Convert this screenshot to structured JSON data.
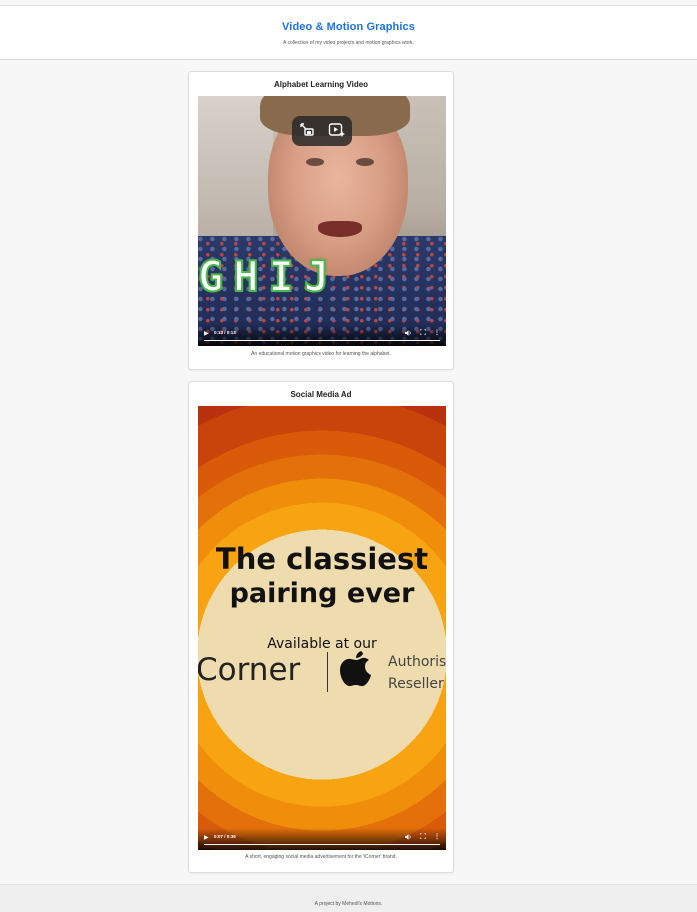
{
  "header": {
    "title": "Video & Motion Graphics",
    "subtitle": "A collection of my video projects and motion graphics work."
  },
  "projects": [
    {
      "title": "Alphabet Learning Video",
      "description": "An educational motion graphics video for learning the alphabet.",
      "overlay_text": "GHIJ",
      "player": {
        "time": "0:13 / 0:13",
        "progress": 1.0,
        "overlay_icons": [
          "picture-in-picture-icon",
          "video-effects-icon"
        ]
      }
    },
    {
      "title": "Social Media Ad",
      "description": "A short, engaging social media advertisement for the 'iCorner' brand.",
      "headline_line1": "The classiest",
      "headline_line2": "pairing ever",
      "available_text": "Available at our",
      "brand_text": "Corner",
      "auth_line1": "Authorised",
      "auth_line2": "Reseller",
      "player": {
        "time": "0:07 / 0:39",
        "progress": 1.0
      }
    }
  ],
  "footer": {
    "text": "A project by Mehedi's Motions."
  },
  "icons": {
    "play": "▶",
    "volume": "🔊",
    "fullscreen": "⛶",
    "more": "⋮"
  },
  "colors": {
    "title_blue": "#1a73e8",
    "ad_orange": "#f08e0c",
    "ad_cream": "#efdcae"
  }
}
